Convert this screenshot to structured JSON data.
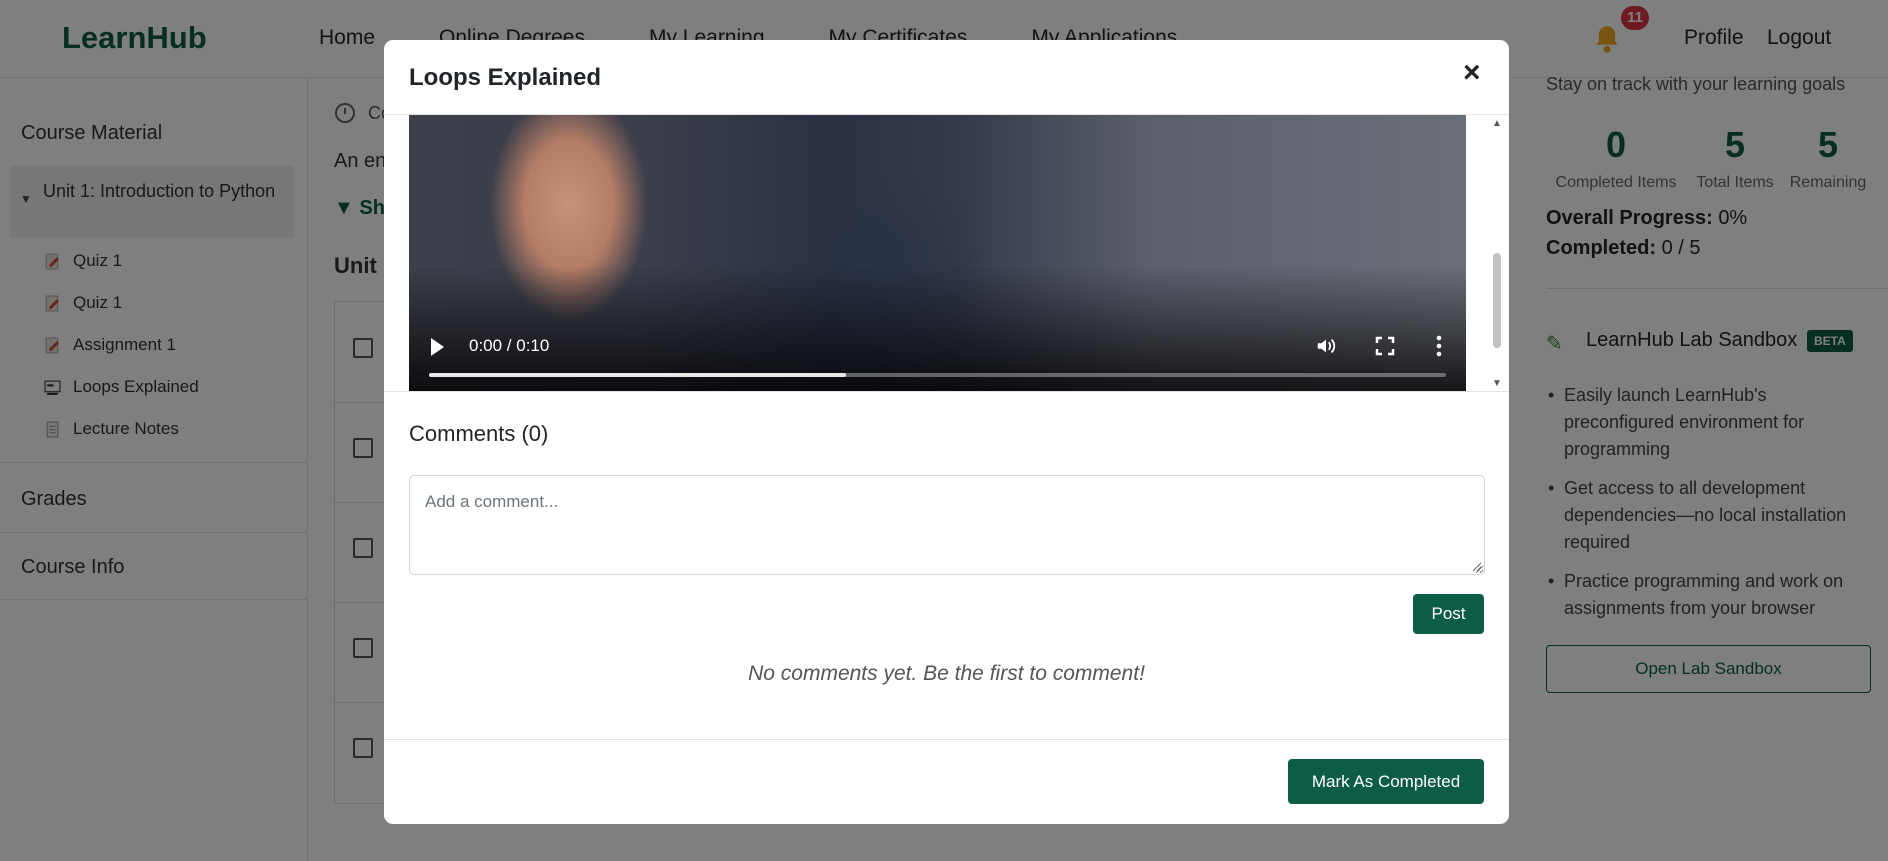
{
  "navbar": {
    "brand": "LearnHub",
    "links": [
      "Home",
      "Online Degrees",
      "My Learning",
      "My Certificates",
      "My Applications"
    ],
    "notification_count": "11",
    "profile": "Profile",
    "logout": "Logout"
  },
  "sidebar": {
    "course_material": "Course Material",
    "unit": "Unit 1: Introduction to Python",
    "items": [
      {
        "label": "Quiz 1",
        "icon": "quiz-icon"
      },
      {
        "label": "Quiz 1",
        "icon": "quiz-icon"
      },
      {
        "label": "Assignment 1",
        "icon": "assignment-icon"
      },
      {
        "label": "Loops Explained",
        "icon": "video-icon"
      },
      {
        "label": "Lecture Notes",
        "icon": "document-icon"
      }
    ],
    "grades": "Grades",
    "course_info": "Course Info"
  },
  "main": {
    "meta": "Co",
    "desc": "An en",
    "show": "Sh",
    "unit_title": "Unit"
  },
  "right_panel": {
    "subtitle": "Stay on track with your learning goals",
    "stats": [
      {
        "value": "0",
        "label": "Completed Items"
      },
      {
        "value": "5",
        "label": "Total Items"
      },
      {
        "value": "5",
        "label": "Remaining"
      }
    ],
    "overall_label": "Overall Progress:",
    "overall_value": "0%",
    "completed_label": "Completed:",
    "completed_value": "0 / 5",
    "lab_title": "LearnHub Lab Sandbox",
    "beta": "BETA",
    "bullets": [
      "Easily launch LearnHub's preconfigured environment for programming",
      "Get access to all development dependencies—no local installation required",
      "Practice programming and work on assignments from your browser"
    ],
    "open_button": "Open Lab Sandbox"
  },
  "modal": {
    "title": "Loops Explained",
    "close": "×",
    "video": {
      "time": "0:00 / 0:10",
      "buffered_fraction": 0.41
    },
    "comments_title": "Comments (0)",
    "comment_placeholder": "Add a comment...",
    "post_button": "Post",
    "no_comments": "No comments yet. Be the first to comment!",
    "mark_button": "Mark As Completed"
  },
  "colors": {
    "brand": "#0d5c46",
    "badge": "#dc3545"
  }
}
